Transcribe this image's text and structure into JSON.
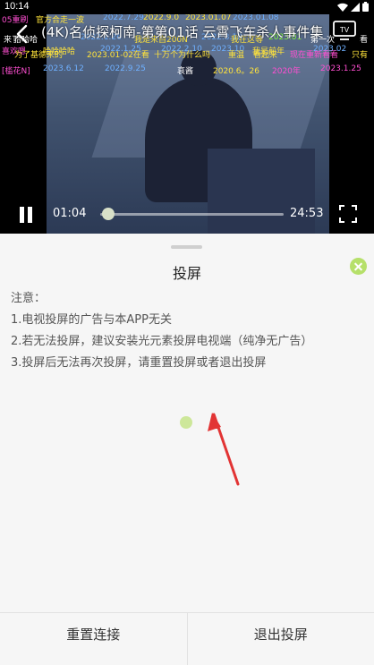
{
  "status_bar": {
    "time": "10:14"
  },
  "video": {
    "title": "(4K)名侦探柯南-第第01话 云霄飞车杀人事件集",
    "current_time": "01:04",
    "total_time": "24:53",
    "progress": 0.043,
    "danmaku": {
      "row0": [
        "05重刷",
        "官方合走一波",
        "2022.7.29",
        "2022.9.0",
        "2023.01.07",
        "2023.01.08"
      ],
      "row1": [
        "来了",
        "哈哈哈",
        "2022.1.26",
        "我是来自200N",
        "2022.3.18",
        "我在这等",
        "2023.01",
        "第一次",
        "看"
      ],
      "row2": [
        "喜欢嗯",
        "哈哈哈哈",
        "2022.1.25",
        "2022.2.10",
        "2023.10",
        "我是前年",
        "2023.02"
      ],
      "row3": [
        "[槛花N]",
        "2023.6.12",
        "2022.9.25",
        "哀酱",
        "2020.6。26",
        "2020年",
        "2023.1.25"
      ],
      "row4": [
        "为了基德来的",
        "2023.01-02在看",
        "十万个为什么吗",
        "重温",
        "看起来",
        "现在重新看看",
        "只有"
      ]
    },
    "colors": {
      "accent": "#d8e0c8",
      "danmaku_green": "#8bff44",
      "danmaku_yellow": "#ffe33b",
      "danmaku_magenta": "#ff4fd2",
      "danmaku_blue": "#6fb0ff"
    }
  },
  "sheet": {
    "title": "投屏",
    "notes": [
      "注意：",
      "1.电视投屏的广告与本APP无关",
      "2.若无法投屏，建议安装光元素投屏电视端（纯净无广告）",
      "3.投屏后无法再次投屏，请重置投屏或者退出投屏"
    ],
    "buttons": {
      "reset": "重置连接",
      "exit": "退出投屏"
    },
    "accent_color": "#b6e06a"
  }
}
